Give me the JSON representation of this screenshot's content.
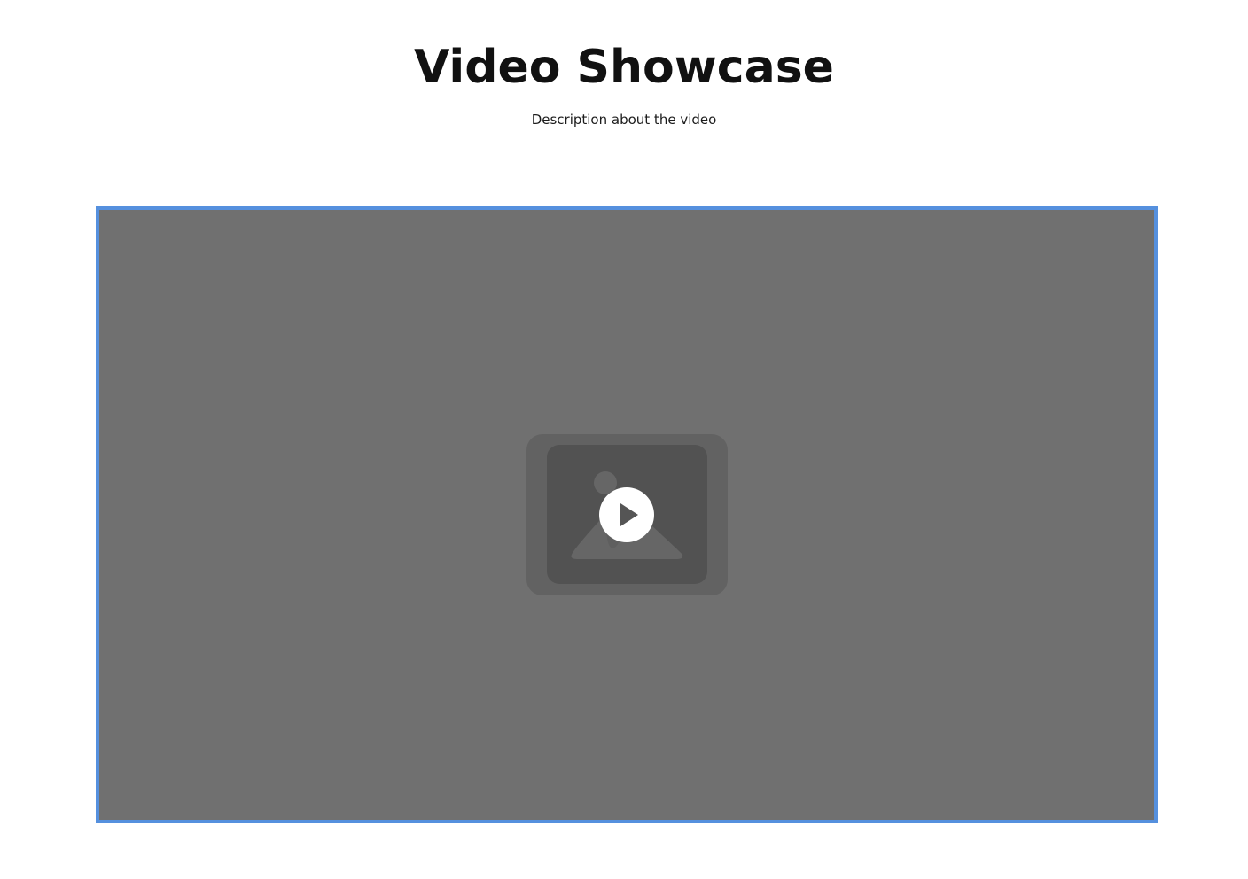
{
  "header": {
    "title": "Video Showcase",
    "description": "Description about the video"
  },
  "video": {
    "state": "paused",
    "play_icon": "play-icon",
    "placeholder_icon": "image-placeholder-icon",
    "colors": {
      "frame": "#707070",
      "border": "#5590de",
      "placeholder_outer": "#626262",
      "placeholder_inner": "#525252",
      "play_button": "#ffffff"
    }
  }
}
